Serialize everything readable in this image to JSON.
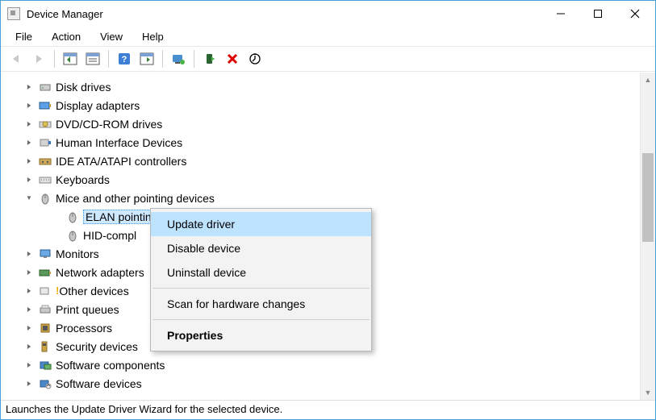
{
  "window": {
    "title": "Device Manager",
    "minimize": "—",
    "maximize": "▢",
    "close": "✕"
  },
  "menu": [
    "File",
    "Action",
    "View",
    "Help"
  ],
  "tree": {
    "items": [
      {
        "label": "Disk drives",
        "icon": "disk"
      },
      {
        "label": "Display adapters",
        "icon": "display"
      },
      {
        "label": "DVD/CD-ROM drives",
        "icon": "dvd"
      },
      {
        "label": "Human Interface Devices",
        "icon": "hid"
      },
      {
        "label": "IDE ATA/ATAPI controllers",
        "icon": "ide"
      },
      {
        "label": "Keyboards",
        "icon": "keyboard"
      },
      {
        "label": "Mice and other pointing devices",
        "icon": "mouse",
        "expanded": true,
        "children": [
          {
            "label": "ELAN pointing device",
            "icon": "mouse",
            "selected": true
          },
          {
            "label": "HID-compl",
            "icon": "mouse"
          }
        ]
      },
      {
        "label": "Monitors",
        "icon": "monitor"
      },
      {
        "label": "Network adapters",
        "icon": "net"
      },
      {
        "label": "Other devices",
        "icon": "other",
        "warn": true
      },
      {
        "label": "Print queues",
        "icon": "print"
      },
      {
        "label": "Processors",
        "icon": "cpu"
      },
      {
        "label": "Security devices",
        "icon": "security"
      },
      {
        "label": "Software components",
        "icon": "softcomp"
      },
      {
        "label": "Software devices",
        "icon": "softdev"
      }
    ]
  },
  "contextmenu": {
    "items": [
      {
        "label": "Update driver",
        "hover": true
      },
      {
        "label": "Disable device"
      },
      {
        "label": "Uninstall device"
      },
      {
        "sep": true
      },
      {
        "label": "Scan for hardware changes"
      },
      {
        "sep": true
      },
      {
        "label": "Properties",
        "bold": true
      }
    ]
  },
  "status": "Launches the Update Driver Wizard for the selected device."
}
